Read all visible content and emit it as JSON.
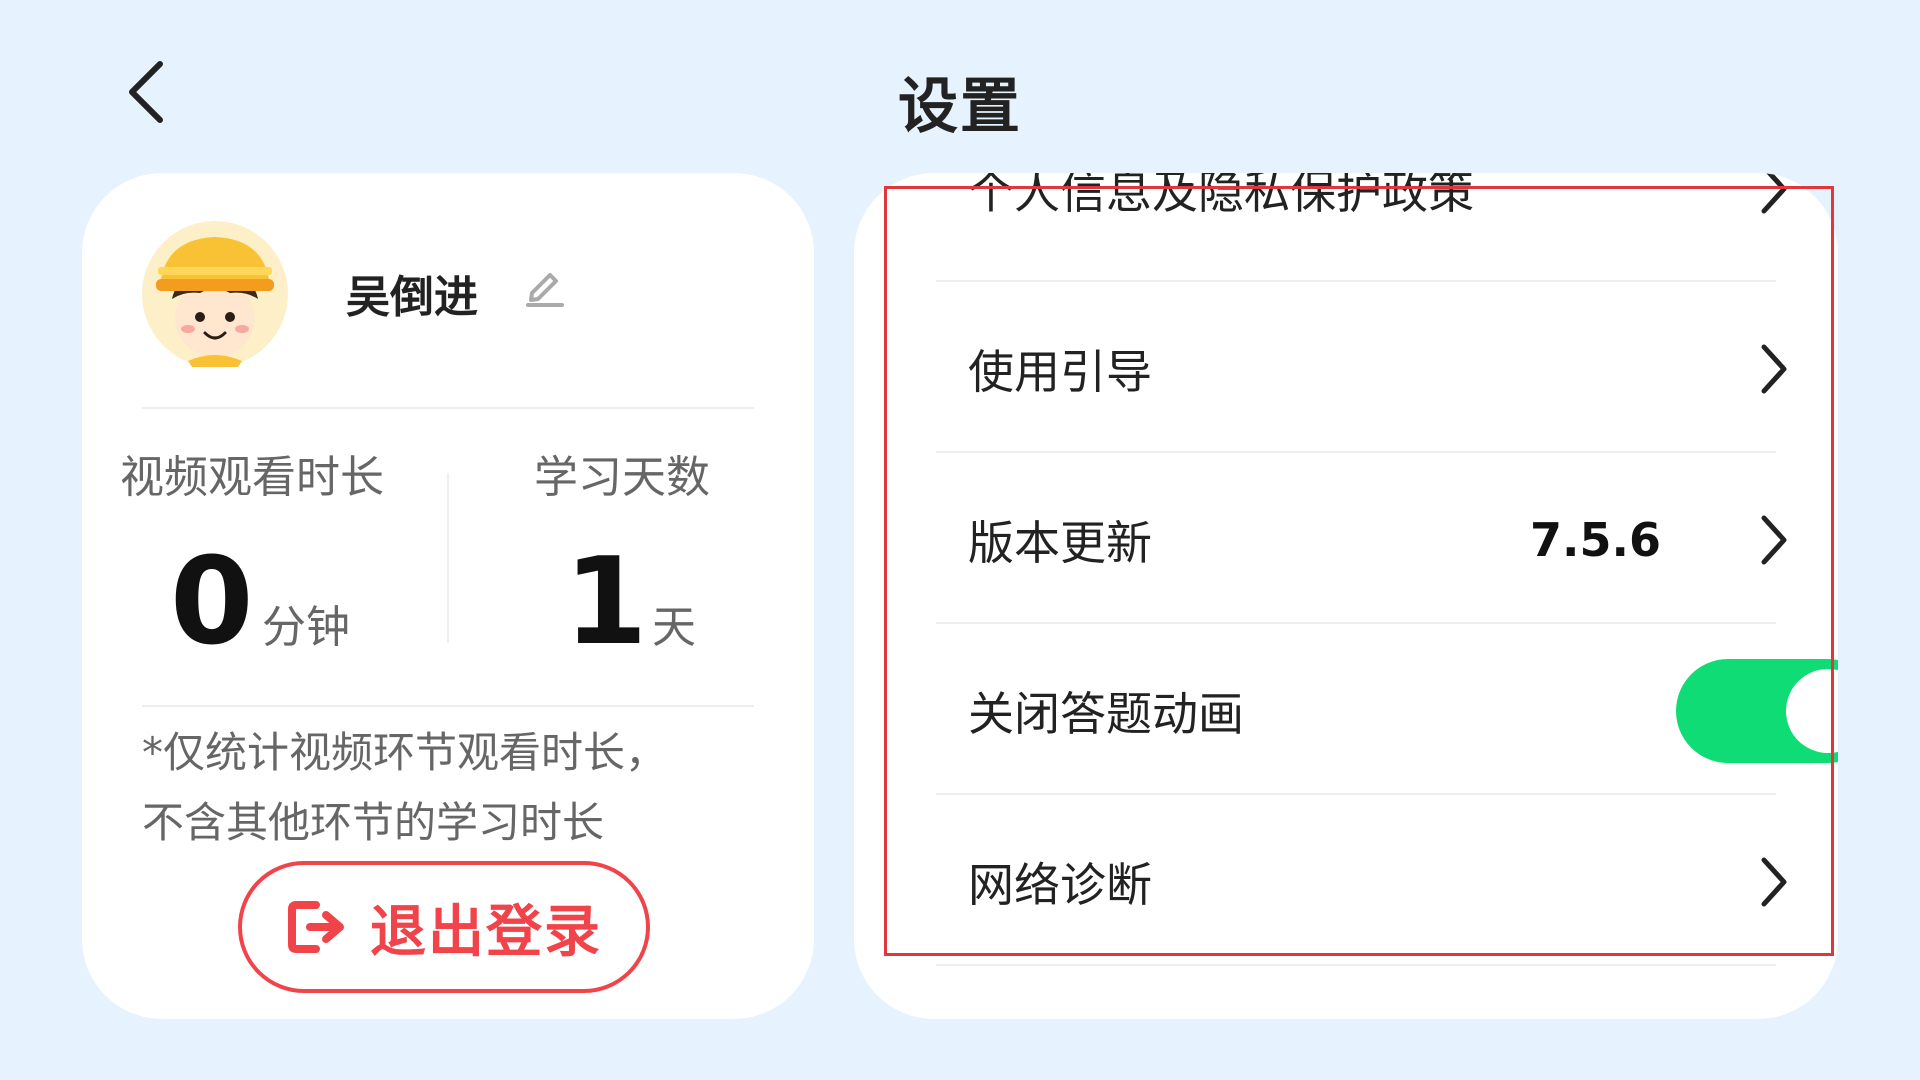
{
  "header": {
    "title": "设置",
    "back_icon": "chevron-left-icon"
  },
  "profile": {
    "username": "吴倒进",
    "avatar_icon": "child-avatar-icon",
    "edit_icon": "pencil-icon",
    "stats": [
      {
        "label": "视频观看时长",
        "value": "0",
        "unit": "分钟"
      },
      {
        "label": "学习天数",
        "value": "1",
        "unit": "天"
      }
    ],
    "note_line1": "*仅统计视频环节观看时长，",
    "note_line2": "不含其他环节的学习时长",
    "logout_label": "退出登录",
    "logout_icon": "logout-icon"
  },
  "settings": {
    "items": [
      {
        "label": "个人信息及隐私保护政策",
        "type": "link"
      },
      {
        "label": "使用引导",
        "type": "link"
      },
      {
        "label": "版本更新",
        "type": "link",
        "value": "7.5.6"
      },
      {
        "label": "关闭答题动画",
        "type": "toggle",
        "checked": true
      },
      {
        "label": "网络诊断",
        "type": "link"
      }
    ]
  },
  "colors": {
    "background": "#e6f2fe",
    "accent_red": "#f0444a",
    "toggle_on": "#0fdc74",
    "highlight_border": "#e0363c"
  }
}
